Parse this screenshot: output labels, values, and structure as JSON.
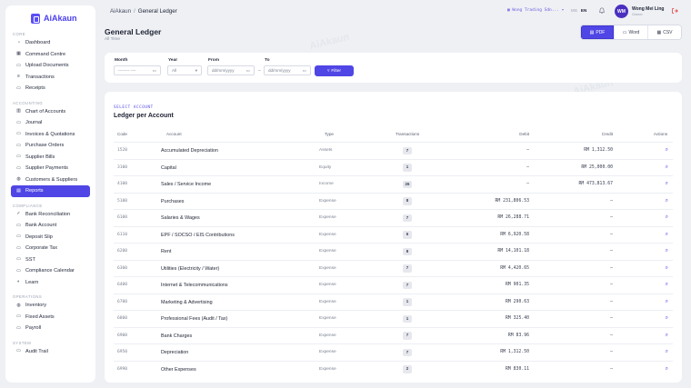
{
  "brand": {
    "name": "AiAkaun"
  },
  "sidebar": {
    "sections": [
      {
        "title": "CORE",
        "items": [
          {
            "label": "Dashboard",
            "icon": "dashboard-icon"
          },
          {
            "label": "Command Centre",
            "icon": "grid-icon"
          },
          {
            "label": "Upload Documents",
            "icon": "upload-icon"
          },
          {
            "label": "Transactions",
            "icon": "list-icon"
          },
          {
            "label": "Receipts",
            "icon": "receipt-icon"
          }
        ]
      },
      {
        "title": "ACCOUNTING",
        "items": [
          {
            "label": "Chart of Accounts",
            "icon": "bar-chart-icon"
          },
          {
            "label": "Journal",
            "icon": "journal-icon"
          },
          {
            "label": "Invoices & Quotations",
            "icon": "invoice-icon"
          },
          {
            "label": "Purchase Orders",
            "icon": "cart-icon"
          },
          {
            "label": "Supplier Bills",
            "icon": "bill-icon"
          },
          {
            "label": "Supplier Payments",
            "icon": "payment-icon"
          },
          {
            "label": "Customers & Suppliers",
            "icon": "users-icon"
          },
          {
            "label": "Reports",
            "icon": "report-icon",
            "active": true
          }
        ]
      },
      {
        "title": "COMPLIANCE",
        "items": [
          {
            "label": "Bank Reconciliation",
            "icon": "check-icon"
          },
          {
            "label": "Bank Account",
            "icon": "bank-icon"
          },
          {
            "label": "Deposit Slip",
            "icon": "deposit-icon"
          },
          {
            "label": "Corporate Tax",
            "icon": "tax-icon"
          },
          {
            "label": "SST",
            "icon": "sst-icon"
          },
          {
            "label": "Compliance Calendar",
            "icon": "calendar-icon"
          },
          {
            "label": "Learn",
            "icon": "learn-icon"
          }
        ]
      },
      {
        "title": "OPERATIONS",
        "items": [
          {
            "label": "Inventory",
            "icon": "inventory-icon"
          },
          {
            "label": "Fixed Assets",
            "icon": "assets-icon"
          },
          {
            "label": "Payroll",
            "icon": "payroll-icon"
          }
        ]
      },
      {
        "title": "SYSTEM",
        "items": [
          {
            "label": "Audit Trail",
            "icon": "audit-icon"
          }
        ]
      }
    ]
  },
  "topbar": {
    "breadcrumb_root": "AiAkaun",
    "breadcrumb_sep": "/",
    "breadcrumb_current": "General Ledger",
    "company": "Wong Trading Sdn...",
    "lang_ms": "MS",
    "lang_en": "EN",
    "avatar_initials": "WM",
    "user_name": "Wong Mei Ling",
    "user_role": "Owner"
  },
  "header": {
    "title": "General Ledger",
    "subtitle": "All Time",
    "export_pdf": "PDF",
    "export_word": "Word",
    "export_csv": "CSV"
  },
  "filters": {
    "month_label": "Month",
    "month_value": "-------- ----",
    "year_label": "Year",
    "year_value": "All",
    "from_label": "From",
    "from_placeholder": "dd/mm/yyyy",
    "to_label": "To",
    "to_placeholder": "dd/mm/yyyy",
    "range_sep": "–",
    "filter_button": "Filter"
  },
  "ledger": {
    "eyebrow": "SELECT ACCOUNT",
    "title": "Ledger per Account",
    "columns": {
      "code": "Code",
      "account": "Account",
      "type": "Type",
      "transactions": "Transactions",
      "debit": "Debit",
      "credit": "Credit",
      "actions": "Actions"
    },
    "rows": [
      {
        "code": "1520",
        "account": "Accumulated Depreciation",
        "type": "Assets",
        "tx": "7",
        "debit": "—",
        "credit": "RM 1,312.50"
      },
      {
        "code": "3100",
        "account": "Capital",
        "type": "Equity",
        "tx": "1",
        "debit": "—",
        "credit": "RM 25,000.00"
      },
      {
        "code": "4100",
        "account": "Sales / Service Income",
        "type": "Income",
        "tx": "26",
        "debit": "—",
        "credit": "RM 473,813.67"
      },
      {
        "code": "5100",
        "account": "Purchases",
        "type": "Expense",
        "tx": "8",
        "debit": "RM 231,806.53",
        "credit": "—"
      },
      {
        "code": "6100",
        "account": "Salaries & Wages",
        "type": "Expense",
        "tx": "7",
        "debit": "RM 26,288.71",
        "credit": "—"
      },
      {
        "code": "6110",
        "account": "EPF / SOCSO / EIS Contributions",
        "type": "Expense",
        "tx": "6",
        "debit": "RM 6,920.58",
        "credit": "—"
      },
      {
        "code": "6200",
        "account": "Rent",
        "type": "Expense",
        "tx": "8",
        "debit": "RM 14,101.18",
        "credit": "—"
      },
      {
        "code": "6300",
        "account": "Utilities (Electricity / Water)",
        "type": "Expense",
        "tx": "7",
        "debit": "RM 4,420.65",
        "credit": "—"
      },
      {
        "code": "6400",
        "account": "Internet & Telecommunications",
        "type": "Expense",
        "tx": "7",
        "debit": "RM 901.35",
        "credit": "—"
      },
      {
        "code": "6700",
        "account": "Marketing & Advertising",
        "type": "Expense",
        "tx": "1",
        "debit": "RM 290.63",
        "credit": "—"
      },
      {
        "code": "6800",
        "account": "Professional Fees (Audit / Tax)",
        "type": "Expense",
        "tx": "1",
        "debit": "RM 325.40",
        "credit": "—"
      },
      {
        "code": "6900",
        "account": "Bank Charges",
        "type": "Expense",
        "tx": "7",
        "debit": "RM 83.96",
        "credit": "—"
      },
      {
        "code": "6950",
        "account": "Depreciation",
        "type": "Expense",
        "tx": "7",
        "debit": "RM 1,312.50",
        "credit": "—"
      },
      {
        "code": "6990",
        "account": "Other Expenses",
        "type": "Expense",
        "tx": "2",
        "debit": "RM 830.11",
        "credit": "—"
      }
    ]
  },
  "colors": {
    "accent": "#4f46e5",
    "background": "#eef0f4"
  }
}
